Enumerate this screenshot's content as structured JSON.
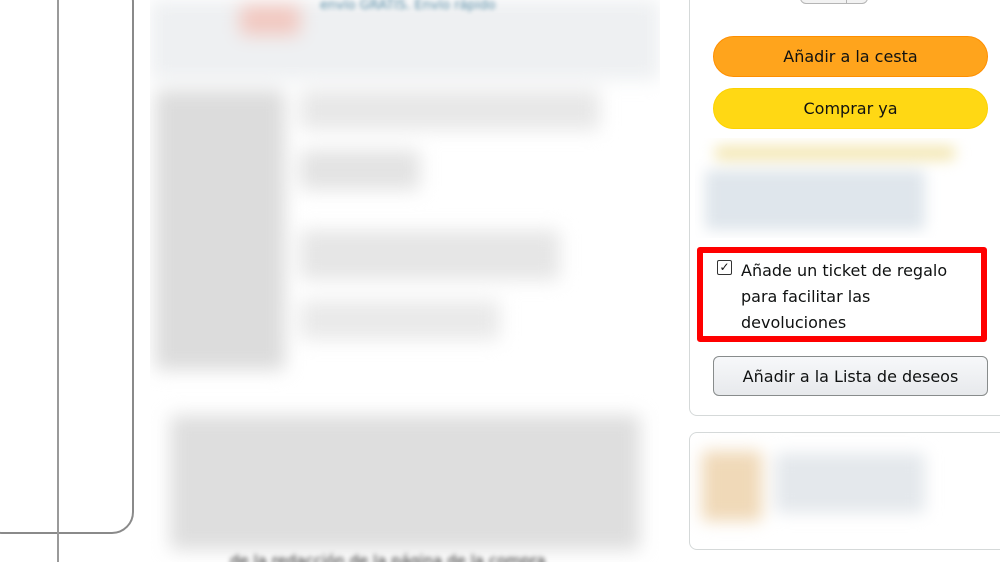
{
  "blurred": {
    "shipping_text": "envío GRATIS. Envío rápido",
    "bottom_text": "de la redacción de la página de la compra"
  },
  "buybox": {
    "add_to_cart_label": "Añadir a la cesta",
    "buy_now_label": "Comprar ya",
    "gift_option": {
      "checked": true,
      "checkbox_mark": "✓",
      "label": "Añade un ticket de regalo para facilitar las devoluciones"
    },
    "wishlist_label": "Añadir a la Lista de deseos"
  },
  "colors": {
    "cart_button": "#ffa41c",
    "buy_button": "#ffd814",
    "highlight": "#ff0000"
  }
}
